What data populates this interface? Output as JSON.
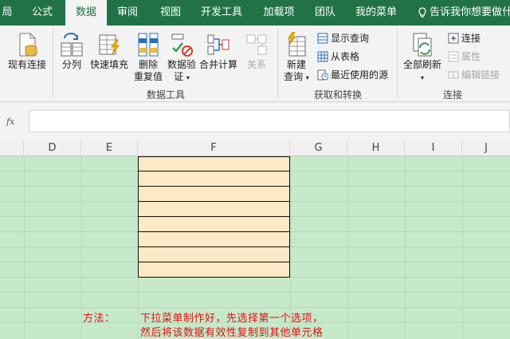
{
  "tabs": [
    {
      "label": "局",
      "active": false
    },
    {
      "label": "公式",
      "active": false
    },
    {
      "label": "数据",
      "active": true
    },
    {
      "label": "审阅",
      "active": false
    },
    {
      "label": "视图",
      "active": false
    },
    {
      "label": "开发工具",
      "active": false
    },
    {
      "label": "加载项",
      "active": false
    },
    {
      "label": "团队",
      "active": false
    },
    {
      "label": "我的菜单",
      "active": false
    }
  ],
  "tell_me": "告诉我你想要做什",
  "ribbon": {
    "existing_connections": "现有连接",
    "split": "分列",
    "flash_fill": "快速填充",
    "remove_dup_1": "删除",
    "remove_dup_2": "重复值",
    "validation_1": "数据验",
    "validation_2": "证",
    "consolidate": "合并计算",
    "relationships": "关系",
    "data_tools_label": "数据工具",
    "new_query_1": "新建",
    "new_query_2": "查询",
    "show_queries": "显示查询",
    "from_table": "从表格",
    "recent_sources": "最近使用的源",
    "get_transform_label": "获取和转换",
    "refresh_all": "全部刷新",
    "connections": "连接",
    "properties": "属性",
    "edit_links": "编辑链接",
    "connections_label": "连接"
  },
  "formula_bar": {
    "fx": "fx",
    "value": ""
  },
  "columns": [
    "D",
    "E",
    "F",
    "G",
    "H",
    "I",
    "J"
  ],
  "note": {
    "label": "方法：",
    "line1": "下拉菜单制作好，先选择第一个选项，",
    "line2": "然后将该数据有效性复制到其他单元格"
  },
  "colors": {
    "ribbon_green": "#217346",
    "sheet_bg": "#c6e9ca",
    "cell_fill": "#fde9c4",
    "note_red": "#e01010"
  }
}
